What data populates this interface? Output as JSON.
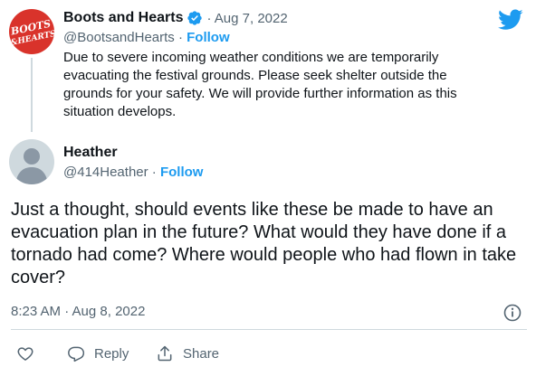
{
  "parent_tweet": {
    "avatar_logo_text": "BOOTS AND HEARTS",
    "display_name": "Boots and Hearts",
    "date": "· Aug 7, 2022",
    "handle": "@BootsandHearts",
    "separator": "·",
    "follow_label": "Follow",
    "body": "Due to severe incoming weather conditions we are temporarily evacuating the festival grounds. Please seek shelter outside the grounds for your safety. We will provide further information as this situation develops."
  },
  "reply_tweet": {
    "display_name": "Heather",
    "handle": "@414Heather",
    "separator": "·",
    "follow_label": "Follow",
    "body": "Just a thought, should events like these be made to have an evacuation plan in the future?  What would they have done if a tornado had come?  Where would people who had flown in take cover?",
    "timestamp": "8:23 AM · Aug 8, 2022"
  },
  "actions": {
    "like_icon": "heart-icon",
    "reply_icon": "comment-icon",
    "reply_label": "Reply",
    "share_icon": "share-icon",
    "share_label": "Share"
  },
  "icons": {
    "brand": "twitter-bird-icon",
    "verified": "verified-badge-icon",
    "info": "info-icon"
  },
  "colors": {
    "accent": "#1d9bf0",
    "text": "#0f1419",
    "muted": "#536471",
    "logo_bg": "#d9332b",
    "divider": "#cfd9de"
  }
}
